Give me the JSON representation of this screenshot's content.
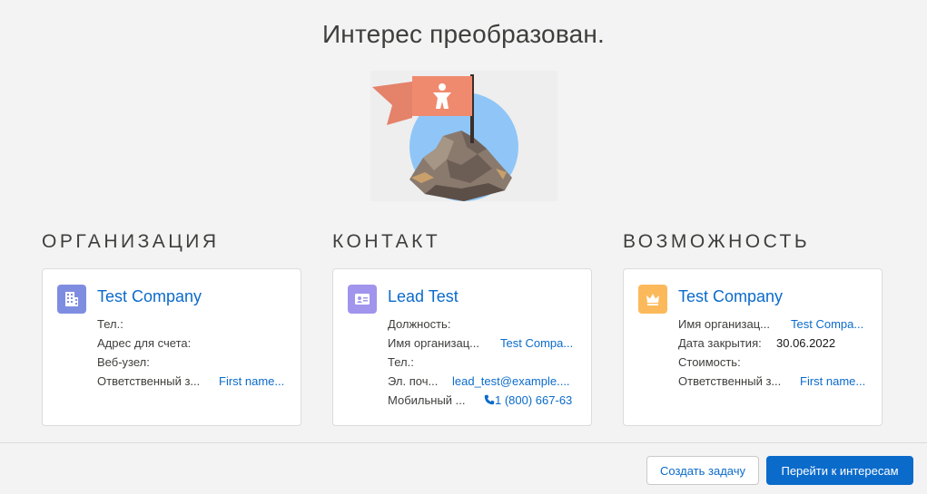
{
  "title": "Интерес преобразован.",
  "colors": {
    "link": "#0b6bcb",
    "brand_button": "#0b6bcb",
    "account_icon_bg": "#7f8de1",
    "contact_icon_bg": "#a094ed",
    "opportunity_icon_bg": "#fcb95b"
  },
  "sections": {
    "account": {
      "heading": "ОРГАНИЗАЦИЯ",
      "icon": "building-icon",
      "name": "Test Company",
      "fields": [
        {
          "label": "Тел.:",
          "value": ""
        },
        {
          "label": "Адрес для счета:",
          "value": ""
        },
        {
          "label": "Веб-узел:",
          "value": ""
        },
        {
          "label": "Ответственный з...",
          "value": "First name..."
        }
      ]
    },
    "contact": {
      "heading": "КОНТАКТ",
      "icon": "contact-card-icon",
      "name": "Lead Test",
      "fields": [
        {
          "label": "Должность:",
          "value": ""
        },
        {
          "label": "Имя организац...",
          "value": "Test Compa..."
        },
        {
          "label": "Тел.:",
          "value": ""
        },
        {
          "label": "Эл. поч...",
          "value": "lead_test@example...."
        },
        {
          "label": "Мобильный ...",
          "value": "1 (800) 667-63"
        }
      ]
    },
    "opportunity": {
      "heading": "ВОЗМОЖНОСТЬ",
      "icon": "crown-icon",
      "name": "Test Company",
      "fields": [
        {
          "label": "Имя организац...",
          "value": "Test Compa..."
        },
        {
          "label": "Дата закрытия:",
          "value": "30.06.2022"
        },
        {
          "label": "Стоимость:",
          "value": ""
        },
        {
          "label": "Ответственный з...",
          "value": "First name..."
        }
      ]
    }
  },
  "footer": {
    "create_task": "Создать задачу",
    "go_to_leads": "Перейти к интересам"
  }
}
